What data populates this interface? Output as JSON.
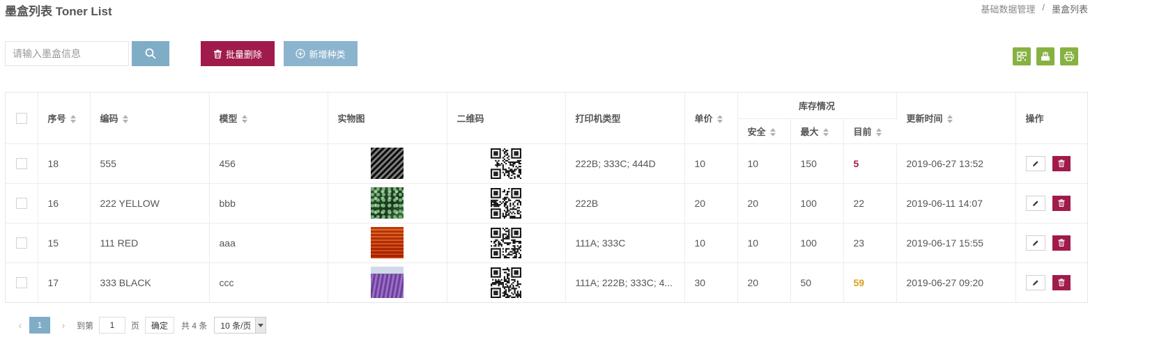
{
  "page": {
    "title": "墨盒列表 Toner List"
  },
  "breadcrumb": {
    "parent": "基础数据管理",
    "separator": "/",
    "current": "墨盒列表"
  },
  "search": {
    "placeholder": "请输入墨盒信息",
    "value": "",
    "button_icon": "search-icon"
  },
  "toolbar": {
    "batch_delete_label": "批量删除",
    "batch_delete_icon": "trash-icon",
    "add_label": "新增种类",
    "add_icon": "plus-circle-icon",
    "tools": [
      "qrcode-icon",
      "export-icon",
      "print-icon"
    ]
  },
  "colors": {
    "danger": "#a01b4b",
    "primary": "#7fadc6",
    "tool": "#87b243",
    "warning_value": "#d5a21a"
  },
  "table": {
    "headers": {
      "seq": "序号",
      "code": "编码",
      "model": "模型",
      "photo": "实物图",
      "qrcode": "二维码",
      "printer_type": "打印机类型",
      "price": "单价",
      "stock": "库存情况",
      "safe": "安全",
      "max": "最大",
      "current": "目前",
      "updated": "更新时间",
      "ops": "操作"
    },
    "rows": [
      {
        "seq": "18",
        "code": "555",
        "model": "456",
        "printer_type": "222B; 333C; 444D",
        "price": "10",
        "safe": "10",
        "max": "150",
        "current": "5",
        "current_status": "low",
        "updated": "2019-06-27 13:52"
      },
      {
        "seq": "16",
        "code": "222 YELLOW",
        "model": "bbb",
        "printer_type": "222B",
        "price": "20",
        "safe": "20",
        "max": "100",
        "current": "22",
        "current_status": "normal",
        "updated": "2019-06-11 14:07"
      },
      {
        "seq": "15",
        "code": "111 RED",
        "model": "aaa",
        "printer_type": "111A; 333C",
        "price": "10",
        "safe": "10",
        "max": "100",
        "current": "23",
        "current_status": "normal",
        "updated": "2019-06-17 15:55"
      },
      {
        "seq": "17",
        "code": "333 BLACK",
        "model": "ccc",
        "printer_type": "111A; 222B; 333C; 4...",
        "price": "30",
        "safe": "20",
        "max": "50",
        "current": "59",
        "current_status": "high",
        "updated": "2019-06-27 09:20"
      }
    ]
  },
  "pagination": {
    "current_page": "1",
    "goto_label": "到第",
    "goto_value": "1",
    "page_unit": "页",
    "confirm_label": "确定",
    "total_label": "共 4 条",
    "page_size_label": "10 条/页"
  }
}
